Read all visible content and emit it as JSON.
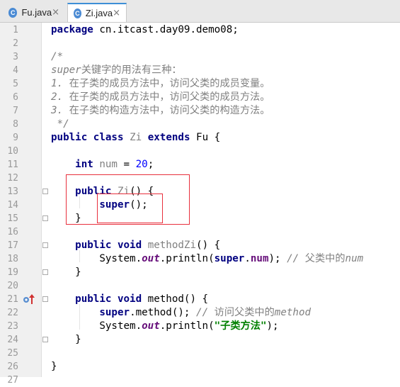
{
  "tabs": [
    {
      "name": "Fu.java",
      "icon": "class-icon",
      "close": "×"
    },
    {
      "name": "Zi.java",
      "icon": "class-icon",
      "close": "×"
    }
  ],
  "lines": [
    {
      "n": "1",
      "tokens": [
        {
          "t": "package",
          "s": "kw"
        },
        {
          "t": " cn.itcast.day09.demo08;"
        }
      ]
    },
    {
      "n": "2",
      "tokens": []
    },
    {
      "n": "3",
      "tokens": [
        {
          "t": "/*",
          "s": "cm"
        }
      ]
    },
    {
      "n": "4",
      "tokens": [
        {
          "t": "super",
          "s": "cm"
        },
        {
          "t": "关键字的用法有三种：",
          "s": "cmcn"
        }
      ]
    },
    {
      "n": "5",
      "tokens": [
        {
          "t": "1. ",
          "s": "cm"
        },
        {
          "t": "在子类的成员方法中，访问父类的成员变量。",
          "s": "cmcn"
        }
      ]
    },
    {
      "n": "6",
      "tokens": [
        {
          "t": "2. ",
          "s": "cm"
        },
        {
          "t": "在子类的成员方法中，访问父类的成员方法。",
          "s": "cmcn"
        }
      ]
    },
    {
      "n": "7",
      "tokens": [
        {
          "t": "3. ",
          "s": "cm"
        },
        {
          "t": "在子类的构造方法中，访问父类的构造方法。",
          "s": "cmcn"
        }
      ]
    },
    {
      "n": "8",
      "tokens": [
        {
          "t": " */",
          "s": "cm"
        }
      ]
    },
    {
      "n": "9",
      "tokens": [
        {
          "t": "public",
          "s": "kw"
        },
        {
          "t": " "
        },
        {
          "t": "class",
          "s": "kw"
        },
        {
          "t": " "
        },
        {
          "t": "Zi",
          "s": "cls"
        },
        {
          "t": " "
        },
        {
          "t": "extends",
          "s": "kw"
        },
        {
          "t": " Fu {"
        }
      ]
    },
    {
      "n": "10",
      "tokens": []
    },
    {
      "n": "11",
      "tokens": [
        {
          "t": "    "
        },
        {
          "t": "int",
          "s": "kw"
        },
        {
          "t": " "
        },
        {
          "t": "num",
          "s": "cls"
        },
        {
          "t": " = "
        },
        {
          "t": "20",
          "s": "num"
        },
        {
          "t": ";"
        }
      ]
    },
    {
      "n": "12",
      "tokens": []
    },
    {
      "n": "13",
      "tokens": [
        {
          "t": "    "
        },
        {
          "t": "public",
          "s": "kw"
        },
        {
          "t": " "
        },
        {
          "t": "Zi",
          "s": "cls"
        },
        {
          "t": "() {"
        }
      ]
    },
    {
      "n": "14",
      "tokens": [
        {
          "t": "        "
        },
        {
          "t": "super",
          "s": "kw"
        },
        {
          "t": "();"
        }
      ]
    },
    {
      "n": "15",
      "tokens": [
        {
          "t": "    }"
        }
      ]
    },
    {
      "n": "16",
      "tokens": []
    },
    {
      "n": "17",
      "tokens": [
        {
          "t": "    "
        },
        {
          "t": "public",
          "s": "kw"
        },
        {
          "t": " "
        },
        {
          "t": "void",
          "s": "kw"
        },
        {
          "t": " "
        },
        {
          "t": "methodZi",
          "s": "cls"
        },
        {
          "t": "() {"
        }
      ]
    },
    {
      "n": "18",
      "tokens": [
        {
          "t": "        System."
        },
        {
          "t": "out",
          "s": "sfld"
        },
        {
          "t": ".println("
        },
        {
          "t": "super",
          "s": "kw"
        },
        {
          "t": "."
        },
        {
          "t": "num",
          "s": "fld"
        },
        {
          "t": "); "
        },
        {
          "t": "// ",
          "s": "cm"
        },
        {
          "t": "父类中的",
          "s": "cmcn"
        },
        {
          "t": "num",
          "s": "cm"
        }
      ]
    },
    {
      "n": "19",
      "tokens": [
        {
          "t": "    }"
        }
      ]
    },
    {
      "n": "20",
      "tokens": []
    },
    {
      "n": "21",
      "tokens": [
        {
          "t": "    "
        },
        {
          "t": "public",
          "s": "kw"
        },
        {
          "t": " "
        },
        {
          "t": "void",
          "s": "kw"
        },
        {
          "t": " method() {"
        }
      ]
    },
    {
      "n": "22",
      "tokens": [
        {
          "t": "        "
        },
        {
          "t": "super",
          "s": "kw"
        },
        {
          "t": ".method(); "
        },
        {
          "t": "// ",
          "s": "cm"
        },
        {
          "t": "访问父类中的",
          "s": "cmcn"
        },
        {
          "t": "method",
          "s": "cm"
        }
      ]
    },
    {
      "n": "23",
      "tokens": [
        {
          "t": "        System."
        },
        {
          "t": "out",
          "s": "sfld"
        },
        {
          "t": ".println("
        },
        {
          "t": "\"",
          "s": "str"
        },
        {
          "t": "子类方法",
          "s": "strcn"
        },
        {
          "t": "\"",
          "s": "str"
        },
        {
          "t": ");"
        }
      ]
    },
    {
      "n": "24",
      "tokens": [
        {
          "t": "    }"
        }
      ]
    },
    {
      "n": "25",
      "tokens": []
    },
    {
      "n": "26",
      "tokens": [
        {
          "t": "}"
        }
      ]
    },
    {
      "n": "27",
      "tokens": []
    }
  ],
  "colors": {
    "keyword": "#000080",
    "comment": "#808080",
    "number": "#0000ff",
    "field": "#660e7a",
    "string": "#008000",
    "highlight_box": "#e8303d"
  }
}
